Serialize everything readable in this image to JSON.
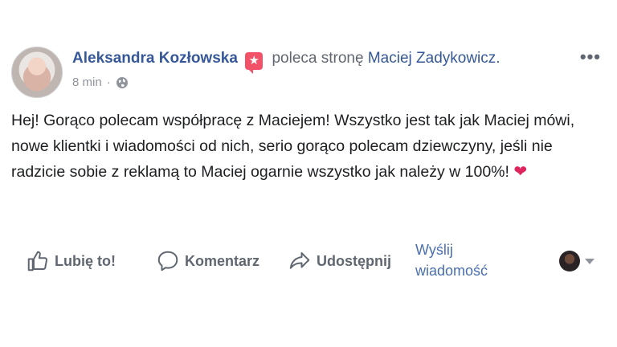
{
  "post": {
    "author": "Aleksandra Kozłowska",
    "recommend_text": "poleca stronę",
    "page_name": "Maciej Zadykowicz.",
    "time": "8 min",
    "separator": "·",
    "more": "•••",
    "body": "Hej! Gorąco polecam współpracę z Maciejem! Wszystko jest tak jak Maciej mówi, nowe klientki i wiadomości od nich, serio gorąco polecam dziewczyny, jeśli nie radzicie sobie z reklamą to Maciej ogarnie wszystko jak należy w 100%!",
    "heart": "❤"
  },
  "actions": {
    "like": "Lubię to!",
    "comment": "Komentarz",
    "share": "Udostępnij",
    "message_line1": "Wyślij",
    "message_line2": "wiadomość"
  },
  "icons": {
    "badge": "recommendation-star-icon",
    "privacy": "globe-icon",
    "like": "thumbs-up-icon",
    "comment": "speech-bubble-icon",
    "share": "share-arrow-icon"
  },
  "colors": {
    "link": "#365899",
    "muted": "#606770",
    "badge": "#f25268",
    "heart": "#e0245e"
  }
}
